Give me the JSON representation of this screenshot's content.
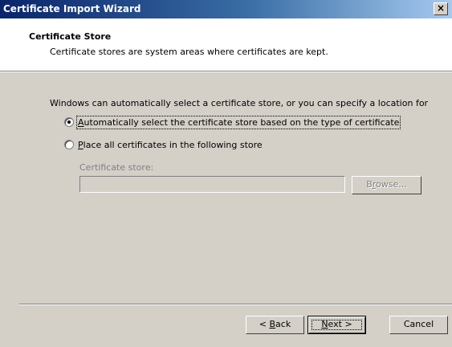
{
  "window": {
    "title": "Certificate Import Wizard",
    "close_glyph": "×"
  },
  "header": {
    "title": "Certificate Store",
    "subtitle": "Certificate stores are system areas where certificates are kept."
  },
  "body": {
    "intro": "Windows can automatically select a certificate store, or you can specify a location for",
    "options": [
      {
        "accel": "A",
        "rest": "utomatically select the certificate store based on the type of certificate",
        "selected": true
      },
      {
        "accel": "P",
        "rest": "lace all certificates in the following store",
        "selected": false
      }
    ],
    "store_label": "Certificate store:",
    "store_value": "",
    "browse": {
      "accel": "r",
      "pre": "B",
      "post": "owse..."
    }
  },
  "footer": {
    "back": {
      "pre": "< ",
      "accel": "B",
      "post": "ack"
    },
    "next": {
      "accel": "N",
      "post": "ext >"
    },
    "cancel": "Cancel"
  },
  "colors": {
    "title_gradient_start": "#0a246a",
    "title_gradient_end": "#a6caf0",
    "face": "#d4d0c8",
    "disabled_text": "#808080"
  }
}
